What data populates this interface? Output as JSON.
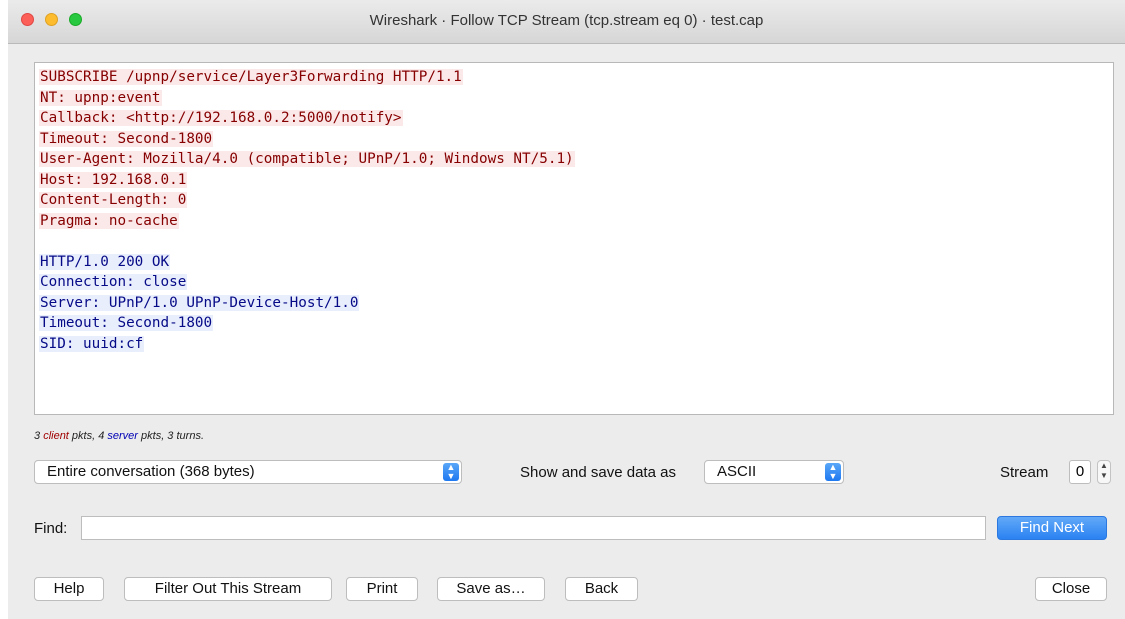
{
  "window": {
    "title": "Wireshark · Follow TCP Stream (tcp.stream eq 0) · test.cap"
  },
  "stream": {
    "client_lines": [
      "SUBSCRIBE /upnp/service/Layer3Forwarding HTTP/1.1",
      "NT: upnp:event",
      "Callback: <http://192.168.0.2:5000/notify>",
      "Timeout: Second-1800",
      "User-Agent: Mozilla/4.0 (compatible; UPnP/1.0; Windows NT/5.1)",
      "Host: 192.168.0.1",
      "Content-Length: 0",
      "Pragma: no-cache"
    ],
    "server_lines": [
      "HTTP/1.0 200 OK",
      "Connection: close",
      "Server: UPnP/1.0 UPnP-Device-Host/1.0",
      "Timeout: Second-1800",
      "SID: uuid:cf"
    ],
    "client_color": "#860000",
    "server_color": "#060a87"
  },
  "stats": {
    "client_count": "3",
    "client_word": "client",
    "mid1": " pkts, 4 ",
    "server_word": "server",
    "mid2": " pkts, 3 turns."
  },
  "controls": {
    "conversation_select": "Entire conversation (368 bytes)",
    "show_save_label": "Show and save data as",
    "format_select": "ASCII",
    "stream_label": "Stream",
    "stream_value": "0",
    "find_label": "Find:",
    "find_value": "",
    "find_next": "Find Next"
  },
  "buttons": {
    "help": "Help",
    "filter_out": "Filter Out This Stream",
    "print": "Print",
    "save_as": "Save as…",
    "back": "Back",
    "close": "Close"
  },
  "icons": {
    "select_arrow": "updown-chevron-icon",
    "stepper": "stepper-icon"
  }
}
